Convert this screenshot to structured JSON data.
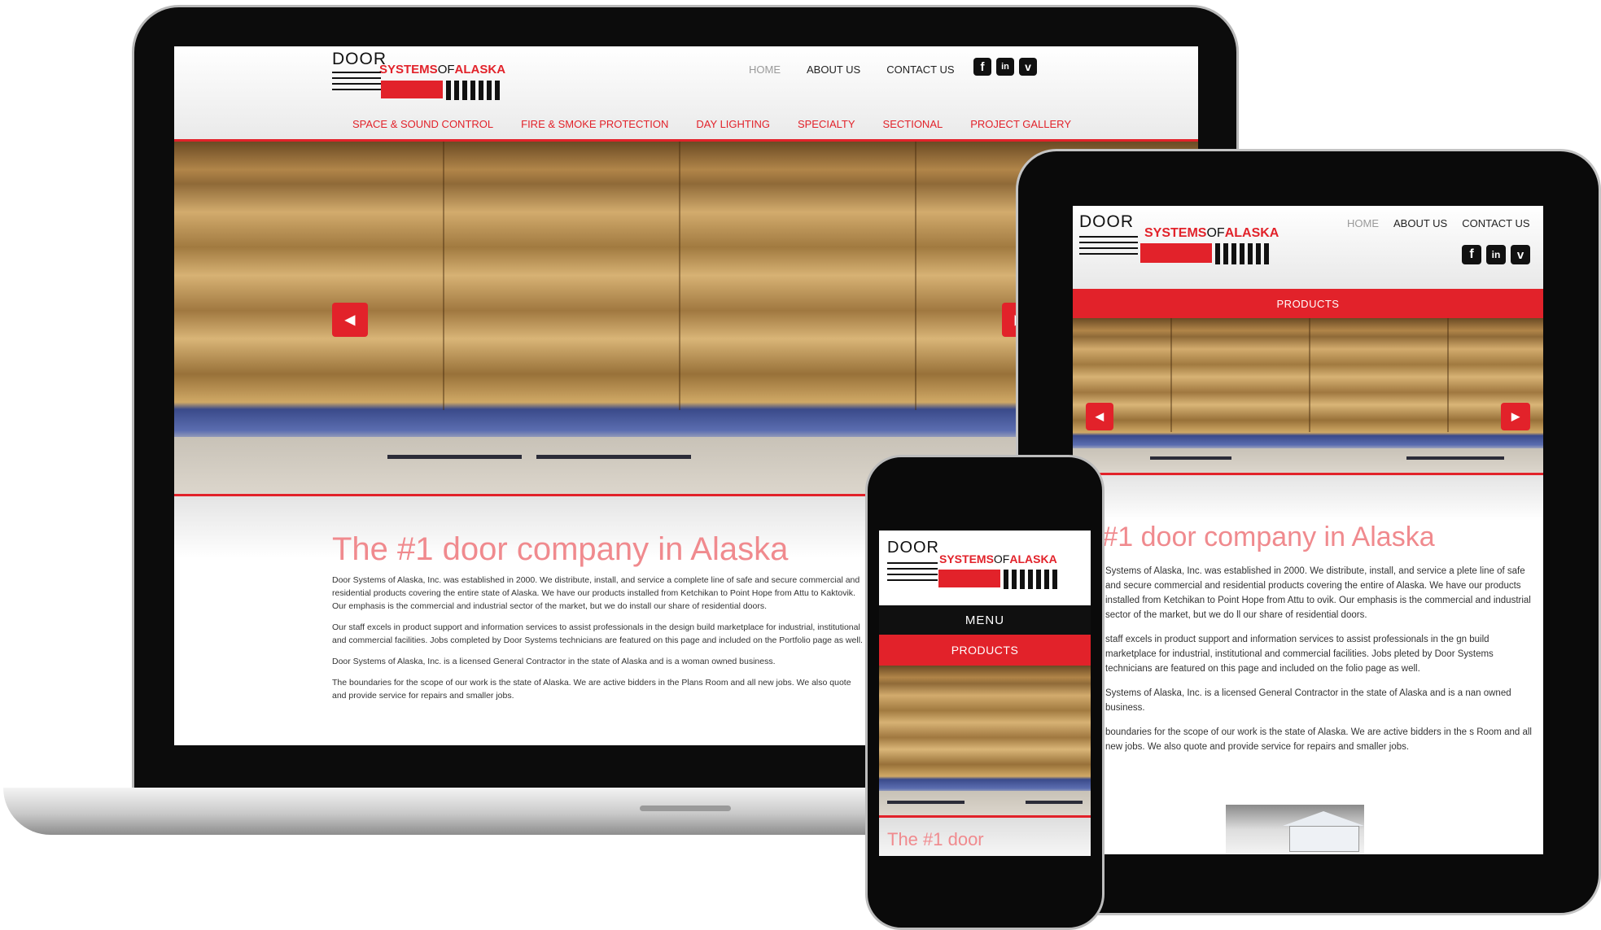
{
  "logo": {
    "word1": "DOOR",
    "systems": "SYSTEMS",
    "of": "OF",
    "alaska": "ALASKA"
  },
  "nav": {
    "home": "HOME",
    "about": "ABOUT US",
    "contact": "CONTACT US"
  },
  "social": {
    "facebook": "f",
    "linkedin": "in",
    "vimeo": "v"
  },
  "categories": [
    "SPACE & SOUND CONTROL",
    "FIRE & SMOKE PROTECTION",
    "DAY LIGHTING",
    "SPECIALTY",
    "SECTIONAL",
    "PROJECT GALLERY"
  ],
  "products_label": "PRODUCTS",
  "menu_label": "MENU",
  "headline": "The #1 door company in Alaska",
  "tablet_headline": "e #1 door company in Alaska",
  "phone_headline": "The #1 door",
  "paragraphs": [
    "Door Systems of Alaska, Inc. was established in 2000. We distribute, install, and service a complete line of safe and secure commercial and residential products covering the entire state of Alaska. We have our products installed from Ketchikan to Point Hope from Attu to Kaktovik. Our emphasis is the commercial and industrial sector of the market, but we do install our share of residential doors.",
    "Our staff excels in product support and information services to assist professionals in the design build marketplace for industrial, institutional and commercial facilities. Jobs completed by Door Systems technicians are featured on this page and included on the Portfolio page as well.",
    "Door Systems of Alaska, Inc. is a licensed General Contractor in the state of Alaska and is a woman owned business.",
    "The boundaries for the scope of our work is the state of Alaska. We are active bidders in the Plans Room and all new jobs. We also quote and provide service for repairs and smaller jobs."
  ],
  "tablet_paragraphs": [
    "Systems of Alaska, Inc. was established in 2000. We distribute, install, and service a plete line of safe and secure commercial and residential products covering the entire of Alaska. We have our products installed from Ketchikan to Point Hope from Attu to ovik. Our emphasis is the commercial and industrial sector of the market, but we do ll our share of residential doors.",
    "staff excels in product support and information services to assist professionals in the gn build marketplace for industrial, institutional and commercial facilities. Jobs pleted by Door Systems technicians are featured on this page and included on the folio page as well.",
    "Systems of Alaska, Inc. is a licensed General Contractor in the state of Alaska and is a nan owned business.",
    "boundaries for the scope of our work is the state of Alaska. We are active bidders in the s Room and all new jobs. We also quote and provide service for repairs and smaller jobs."
  ],
  "arrows": {
    "prev": "◀",
    "next": "▶"
  },
  "colors": {
    "accent": "#e2222a",
    "headline": "#f08a8e",
    "frame": "#0c0c0c"
  }
}
